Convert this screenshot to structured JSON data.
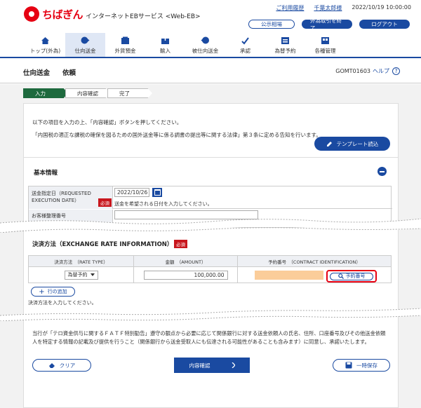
{
  "header": {
    "logo_name": "ちばぎん",
    "service_name": "インターネットEBサービス <Web-EB>",
    "usage_history": "ご利用履歴",
    "user_name": "千葉太郎様",
    "datetime": "2022/10/19 10:00:00",
    "public_market": "公示相場",
    "end_fx": "外為取引を終了",
    "logout": "ログアウト"
  },
  "nav": [
    {
      "label": "トップ(外為)",
      "icon": "home-icon"
    },
    {
      "label": "仕向送金",
      "icon": "send-icon"
    },
    {
      "label": "外貨預金",
      "icon": "deposit-icon"
    },
    {
      "label": "輸入",
      "icon": "import-icon"
    },
    {
      "label": "被仕向送金",
      "icon": "receive-icon"
    },
    {
      "label": "承認",
      "icon": "approve-icon"
    },
    {
      "label": "為替予約",
      "icon": "forward-icon"
    },
    {
      "label": "各種管理",
      "icon": "manage-icon"
    }
  ],
  "page": {
    "title1": "仕向送金",
    "title2": "依頼",
    "code": "GOMT01603",
    "help": "ヘルプ",
    "help_mark": "?"
  },
  "steps": [
    "入力",
    "内容確認",
    "完了"
  ],
  "intro": {
    "line1": "以下の項目を入力の上、「内容確認」ボタンを押してください。",
    "line2": "「内国税の適正な課税の確保を図るための国外送金等に係る調書の提出等に関する法律」第３条に定める告知を行います。",
    "template_button": "テンプレート読込"
  },
  "basic": {
    "title": "基本情報",
    "date_label_1": "送金指定日（REQUESTED",
    "date_label_2": "EXECUTION DATE）",
    "required": "必須",
    "date_value": "2022/10/26",
    "date_hint": "送金を希望される日付を入力してください。",
    "ref_label": "お客様整理番号"
  },
  "rate": {
    "title": "決済方法（EXCHANGE RATE INFORMATION）",
    "required": "必須",
    "col_method": "決済方法　（RATE TYPE）",
    "col_amount": "金額　（AMOUNT）",
    "col_contract": "予約番号　（CONTRACT IDENTIFICATION）",
    "method_value": "為替予約",
    "amount_value": "100,000.00",
    "reserve_button": "予約番号",
    "add_row": "行の追加",
    "hint": "決済方法を入力してください。"
  },
  "notice": {
    "text": "当行が「テロ資金供与に関するＦＡＴＦ特別勧告」遵守の観点から必要に応じて関係銀行に対する送金依頼人の氏名、住所、口座番号及びその他送金依頼人を特定する情報の記載及び提供を行うこと（関係銀行から送金受取人にも伝達される可能性があることも含みます）に同意し、承諾いたします。"
  },
  "actions": {
    "clear": "クリア",
    "confirm": "内容確認",
    "save": "一時保存"
  }
}
